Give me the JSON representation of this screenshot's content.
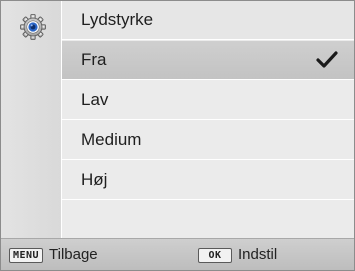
{
  "menu": {
    "icon": "gear-icon",
    "title": "Lydstyrke",
    "options": [
      {
        "label": "Fra",
        "selected": true
      },
      {
        "label": "Lav",
        "selected": false
      },
      {
        "label": "Medium",
        "selected": false
      },
      {
        "label": "Høj",
        "selected": false
      }
    ],
    "selected_indicator_icon": "checkmark-icon"
  },
  "footer": {
    "menu_key": "MENU",
    "menu_label": "Tilbage",
    "ok_key": "OK",
    "ok_label": "Indstil"
  },
  "colors": {
    "accent_blue": "#2a66c8",
    "selected_row": "#c9c9c9",
    "row_bg": "#ebebeb"
  }
}
